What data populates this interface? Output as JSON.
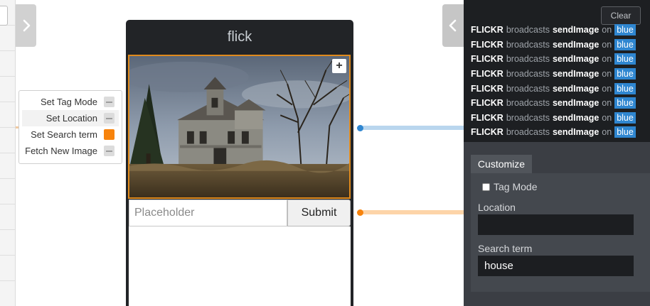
{
  "widget": {
    "title": "flick",
    "search_placeholder": "Placeholder",
    "submit_label": "Submit",
    "image_alt": "Abandoned wooden farmhouse under a cloudy sky"
  },
  "inputs_node": {
    "items": [
      {
        "label": "Set Tag Mode",
        "active": false
      },
      {
        "label": "Set Location",
        "active": false
      },
      {
        "label": "Set Search term",
        "active": true
      },
      {
        "label": "Fetch New Image",
        "active": false
      }
    ]
  },
  "log_panel": {
    "clear_label": "Clear",
    "entries": [
      {
        "source": "FLICKR",
        "verb": "broadcasts",
        "event": "sendImage",
        "prep": "on",
        "channel": "blue"
      },
      {
        "source": "FLICKR",
        "verb": "broadcasts",
        "event": "sendImage",
        "prep": "on",
        "channel": "blue"
      },
      {
        "source": "FLICKR",
        "verb": "broadcasts",
        "event": "sendImage",
        "prep": "on",
        "channel": "blue"
      },
      {
        "source": "FLICKR",
        "verb": "broadcasts",
        "event": "sendImage",
        "prep": "on",
        "channel": "blue"
      },
      {
        "source": "FLICKR",
        "verb": "broadcasts",
        "event": "sendImage",
        "prep": "on",
        "channel": "blue"
      },
      {
        "source": "FLICKR",
        "verb": "broadcasts",
        "event": "sendImage",
        "prep": "on",
        "channel": "blue"
      },
      {
        "source": "FLICKR",
        "verb": "broadcasts",
        "event": "sendImage",
        "prep": "on",
        "channel": "blue"
      },
      {
        "source": "FLICKR",
        "verb": "broadcasts",
        "event": "sendImage",
        "prep": "on",
        "channel": "blue"
      }
    ]
  },
  "customize": {
    "tab_label": "Customize",
    "tag_mode_label": "Tag Mode",
    "tag_mode_checked": false,
    "location_label": "Location",
    "location_value": "",
    "search_term_label": "Search term",
    "search_term_value": "house"
  },
  "icons": {
    "expand": "chevron-right-icon",
    "collapse": "chevron-left-icon",
    "zoom": "plus-icon"
  },
  "colors": {
    "accent_orange": "#f7830c",
    "channel_blue": "#2f86d0",
    "wire_blue": "#b9d6ee",
    "wire_orange": "#fdd4a8"
  }
}
